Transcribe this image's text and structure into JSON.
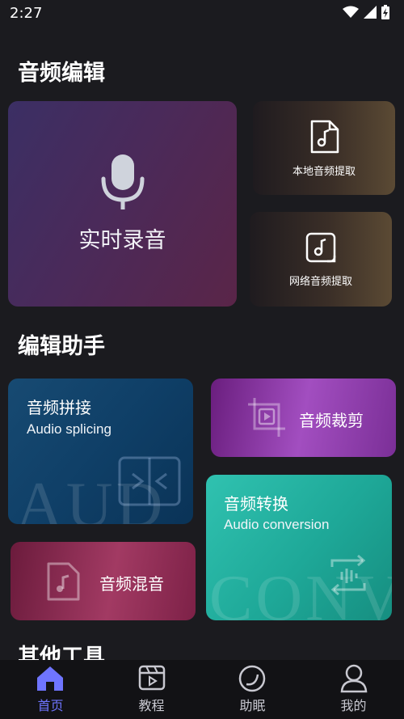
{
  "status_bar": {
    "time": "2:27"
  },
  "sections": {
    "audio_edit": "音频编辑",
    "edit_assistant": "编辑助手",
    "other_tools": "其他工具"
  },
  "audio_edit": {
    "record": "实时录音",
    "local_extract": "本地音频提取",
    "network_extract": "网络音频提取"
  },
  "assistant": {
    "splice_title": "音频拼接",
    "splice_sub": "Audio splicing",
    "splice_watermark": "AUD",
    "cut_title": "音频裁剪",
    "mix_title": "音频混音",
    "convert_title": "音频转换",
    "convert_sub": "Audio conversion",
    "convert_watermark": "CONV"
  },
  "bottom_nav": {
    "home": "首页",
    "tutorial": "教程",
    "sleep": "助眠",
    "mine": "我的"
  },
  "colors": {
    "accent": "#6f75ff",
    "background": "#1b1b1f"
  }
}
